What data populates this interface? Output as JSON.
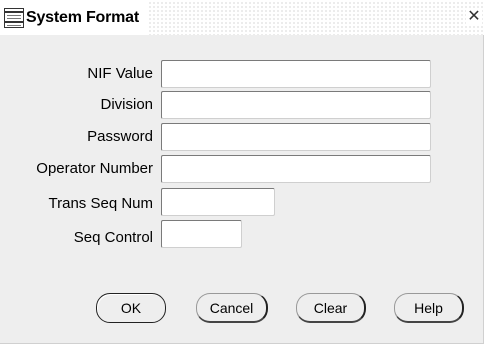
{
  "window": {
    "title": "System Format",
    "icon": "form-window-icon",
    "close_glyph": "✕"
  },
  "form": {
    "fields": [
      {
        "label": "NIF Value",
        "value": ""
      },
      {
        "label": "Division",
        "value": ""
      },
      {
        "label": "Password",
        "value": ""
      },
      {
        "label": "Operator Number",
        "value": ""
      },
      {
        "label": "Trans Seq Num",
        "value": ""
      },
      {
        "label": "Seq Control",
        "value": ""
      }
    ]
  },
  "buttons": {
    "ok": "OK",
    "cancel": "Cancel",
    "clear": "Clear",
    "help": "Help"
  }
}
